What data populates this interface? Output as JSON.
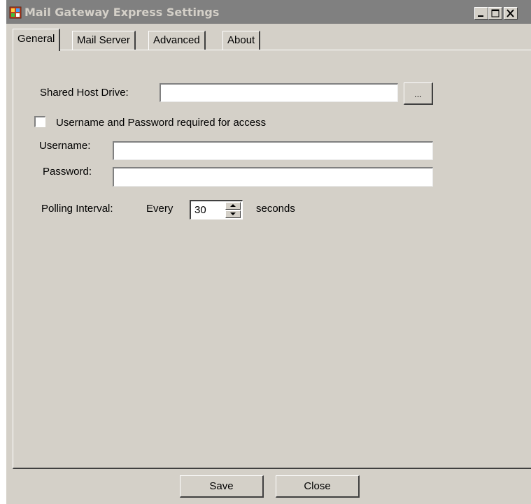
{
  "window": {
    "title": "Mail Gateway Express Settings",
    "colors": {
      "titlebar": "#808080",
      "title_text": "#d4d0c8",
      "face": "#d4d0c8"
    }
  },
  "titlebar_buttons": {
    "minimize": "minimize-icon",
    "maximize": "maximize-icon",
    "close": "close-icon"
  },
  "tabs": [
    {
      "label": "General",
      "active": true
    },
    {
      "label": "Mail Server",
      "active": false
    },
    {
      "label": "Advanced",
      "active": false
    },
    {
      "label": "About",
      "active": false
    }
  ],
  "general": {
    "shared_host_drive": {
      "label": "Shared Host Drive:",
      "value": "",
      "browse_label": "..."
    },
    "auth_checkbox": {
      "label": "Username and Password required for access",
      "checked": false
    },
    "username": {
      "label": "Username:",
      "value": ""
    },
    "password": {
      "label": "Password:",
      "value": ""
    },
    "polling": {
      "label": "Polling Interval:",
      "prefix": "Every",
      "value": "30",
      "suffix": "seconds"
    }
  },
  "footer": {
    "save_label": "Save",
    "close_label": "Close"
  }
}
